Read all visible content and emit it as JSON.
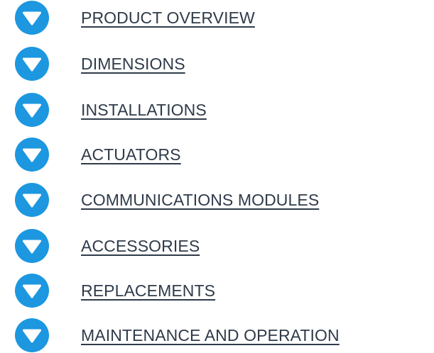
{
  "accordion": {
    "accent_color": "#1c97e0",
    "label_color": "#2f3b4a",
    "icon": "chevron-down-circle-icon",
    "items": [
      {
        "label": "PRODUCT OVERVIEW"
      },
      {
        "label": "DIMENSIONS"
      },
      {
        "label": "INSTALLATIONS"
      },
      {
        "label": "ACTUATORS"
      },
      {
        "label": "COMMUNICATIONS MODULES"
      },
      {
        "label": "ACCESSORIES"
      },
      {
        "label": "REPLACEMENTS"
      },
      {
        "label": "MAINTENANCE AND OPERATION"
      }
    ]
  }
}
